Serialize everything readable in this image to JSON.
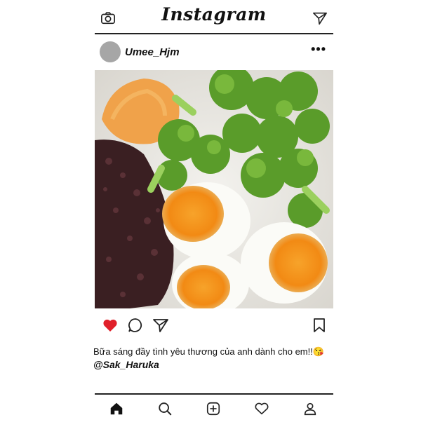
{
  "header": {
    "logo_text": "Instagram",
    "left_icon": "camera-icon",
    "right_icon": "paper-plane-icon"
  },
  "post": {
    "username": "Umee_Hjm",
    "more_label": "•••",
    "image_alt_icon": "photo-breakfast",
    "liked": true,
    "like_color": "#e0202a",
    "caption": "Bữa sáng đầy tình yêu thương của anh dành cho em!!😘",
    "mention": "@Sak_Haruka"
  },
  "actions": [
    "heart-icon",
    "comment-icon",
    "share-icon",
    "bookmark-icon"
  ],
  "bottom_nav": [
    "home-icon",
    "search-icon",
    "add-post-icon",
    "activity-heart-icon",
    "profile-icon"
  ]
}
